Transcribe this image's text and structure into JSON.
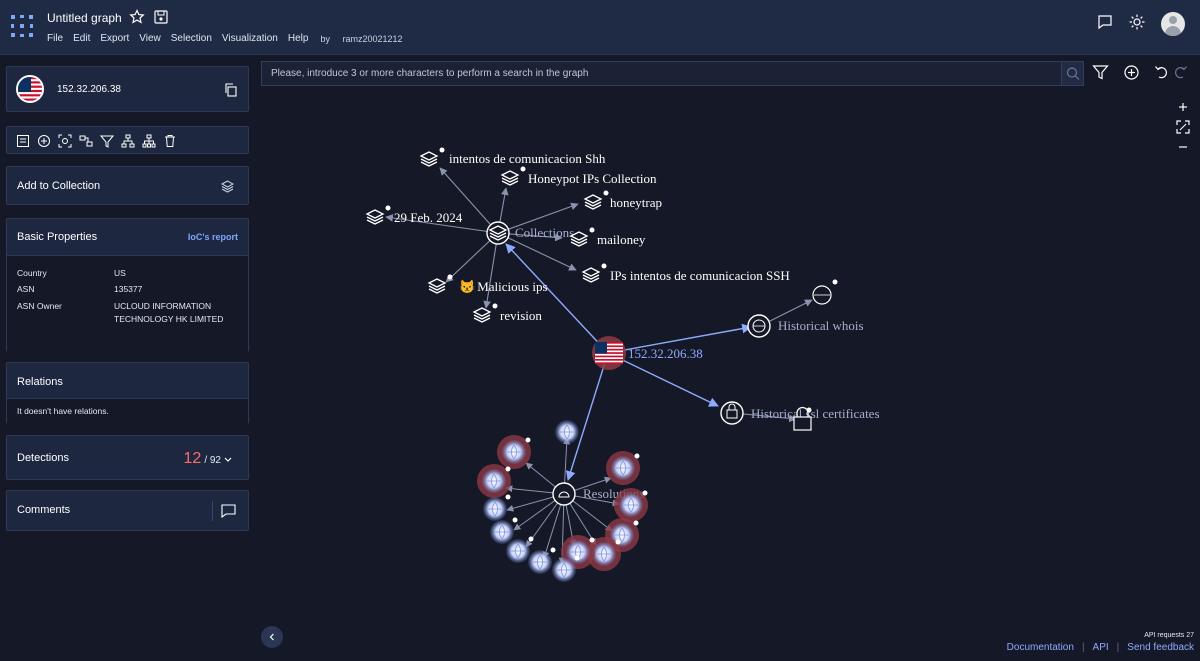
{
  "header": {
    "title": "Untitled graph",
    "menu": [
      "File",
      "Edit",
      "Export",
      "View",
      "Selection",
      "Visualization",
      "Help"
    ],
    "by_label": "by",
    "username": "ramz20021212"
  },
  "panel": {
    "ip": "152.32.206.38",
    "add_to_collection": "Add to Collection",
    "basic_properties": "Basic Properties",
    "ioc_report": "IoC's report",
    "properties": [
      {
        "key": "Country",
        "value": "US"
      },
      {
        "key": "ASN",
        "value": "135377"
      },
      {
        "key": "ASN Owner",
        "value": "UCLOUD INFORMATION TECHNOLOGY HK LIMITED"
      }
    ],
    "relations_title": "Relations",
    "relations_empty": "It doesn't have relations.",
    "detections_title": "Detections",
    "detections_count": "12",
    "detections_total": "/ 92",
    "comments_title": "Comments"
  },
  "search": {
    "placeholder": "Please, introduce 3 or more characters to perform a search in the graph"
  },
  "graph": {
    "center_label": "152.32.206.38",
    "collections_label": "Collections",
    "whois_label": "Historical whois",
    "ssl_label": "Historical ssl certificates",
    "resolutions_label": "Resolutions",
    "collection_nodes": [
      "intentos de comunicacion Shh",
      "Honeypot IPs Collection",
      "honeytrap",
      "29 Feb. 2024",
      "mailoney",
      "IPs intentos de comunicacion SSH",
      "Malicious ips",
      "revision"
    ],
    "malicious_emoji": "😾"
  },
  "footer": {
    "api_requests": "API requests 27",
    "documentation": "Documentation",
    "api": "API",
    "feedback": "Send feedback"
  },
  "colors": {
    "accent": "#8eaaff",
    "detections": "#ff6b6b",
    "header_bg": "#1f2a44",
    "canvas_bg": "#151826"
  }
}
